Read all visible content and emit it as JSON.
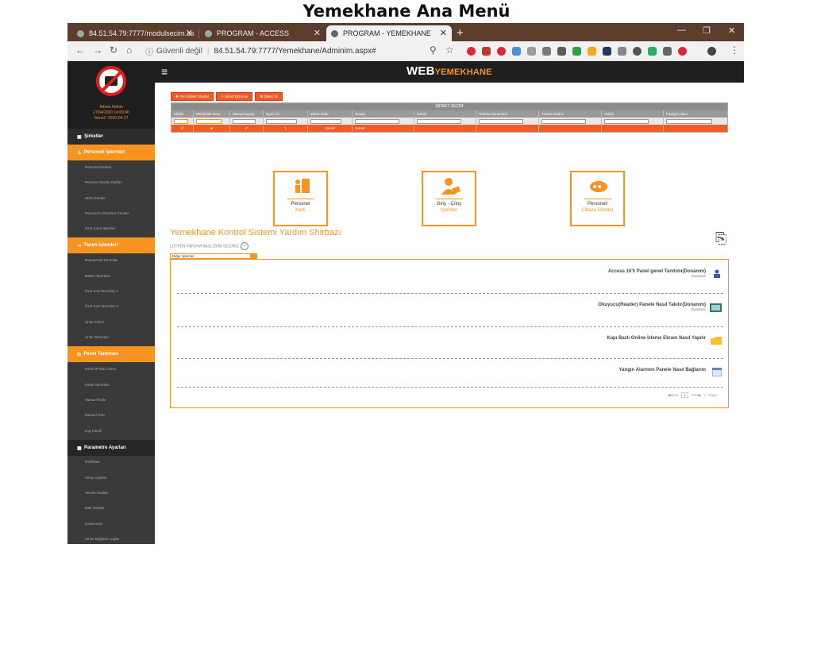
{
  "page_title": "Yemekhane Ana Menü",
  "browser": {
    "tabs": [
      {
        "label": "84.51.54.79:7777/modulsecim.as"
      },
      {
        "label": "PROGRAM - ACCESS"
      },
      {
        "label": "PROGRAM - YEMEKHANE"
      }
    ],
    "security_label": "Güvenli değil",
    "url": "84.51.54.79:7777/Yemekhane/Adminim.aspx#"
  },
  "app": {
    "brand_main": "WEB",
    "brand_sub": "YEMEKHANE",
    "user_name": "Admin Admin",
    "user_datetime": "27/04/2020 14:00:40",
    "user_extra": "Genel / 2020-04-27"
  },
  "sidebar": {
    "sirketler": "Şirketler",
    "personel_islemleri": "Personel İşlemleri",
    "personel_items": [
      "Personel Kartları",
      "Personel Modlu Kartları",
      "SMS Gönder",
      "Personeli Cihazlara Gönder",
      "Giriş Çıkış İşlemleri"
    ],
    "tanim_islemleri": "Tanım İşlemleri",
    "tanim_items": [
      "Departman Tanımları",
      "Bölüm Tanımları",
      "Özel Kod Tanımları 1",
      "Özel Kod Tanımları 2",
      "Ünite Türleri",
      "Ünite Tanımları"
    ],
    "panel_tanimlari": "Panel Tanımları",
    "panel_items": [
      "Panel IP Mac Adres",
      "Panel Tanımları",
      "Manuel Rölle",
      "Manuel Isıtıc",
      "Log Paneli"
    ],
    "parametre_ayarlari": "Parametre Ayarları",
    "parametre_items": [
      "Özellikler",
      "Cihaz Ayarları",
      "Yemek Kodları",
      "Mail Gönder",
      "Kullanıcılar",
      "Cihaz Bağlantı Loglar"
    ]
  },
  "toolbar": {
    "yeni": "Yeni Şirket Oluştur",
    "duzenle": "Şirket Düzenle",
    "sil": "Şirket Sil"
  },
  "grid": {
    "title": "ŞİRKET SEÇİM",
    "headers": [
      "Aktifm",
      "Müdahale Dem",
      "Manuel ayraç",
      "İşyeri no",
      "Şirket kodu",
      "Ünvan",
      "Genel",
      "Telefax Denemesi",
      "Ticaret Sicilno",
      "Yetkili",
      "Faaliyet Alanı"
    ],
    "row": [
      "☑",
      "■",
      "#",
      "1",
      "Genel",
      "Genel",
      "",
      "",
      "",
      "",
      ""
    ]
  },
  "cards": [
    {
      "line1": "Personel",
      "line2": "Kartı"
    },
    {
      "line1": "Giriş - Çıkış",
      "line2": "İşlemler"
    },
    {
      "line1": "Personeli",
      "line2": "Cihaza Gönder"
    }
  ],
  "help": {
    "title": "Yemekhane Kontrol Sistemi Yardım Shirbazı",
    "subtitle": "LÜTFEN YARDIM BAŞLIĞINI SEÇİNİZ",
    "select_value": "Diğer İşlemler",
    "items": [
      {
        "title": "Access 16'lı Panel genel Tanıtımı(Donanım)",
        "category": "Donanım"
      },
      {
        "title": "Okuyucu(Reader) Panele Nasıl Takılır(Donanım)",
        "category": "Donanım"
      },
      {
        "title": "Kapı Bazlı Online İzleme Ekranı Nasıl Yapılır",
        "category": ""
      },
      {
        "title": "Yangın Alarmını Panele Nasıl Bağlarım",
        "category": ""
      }
    ],
    "pager": {
      "prev": "Back",
      "page": "1",
      "next": "Prev",
      "label": "Page"
    }
  }
}
